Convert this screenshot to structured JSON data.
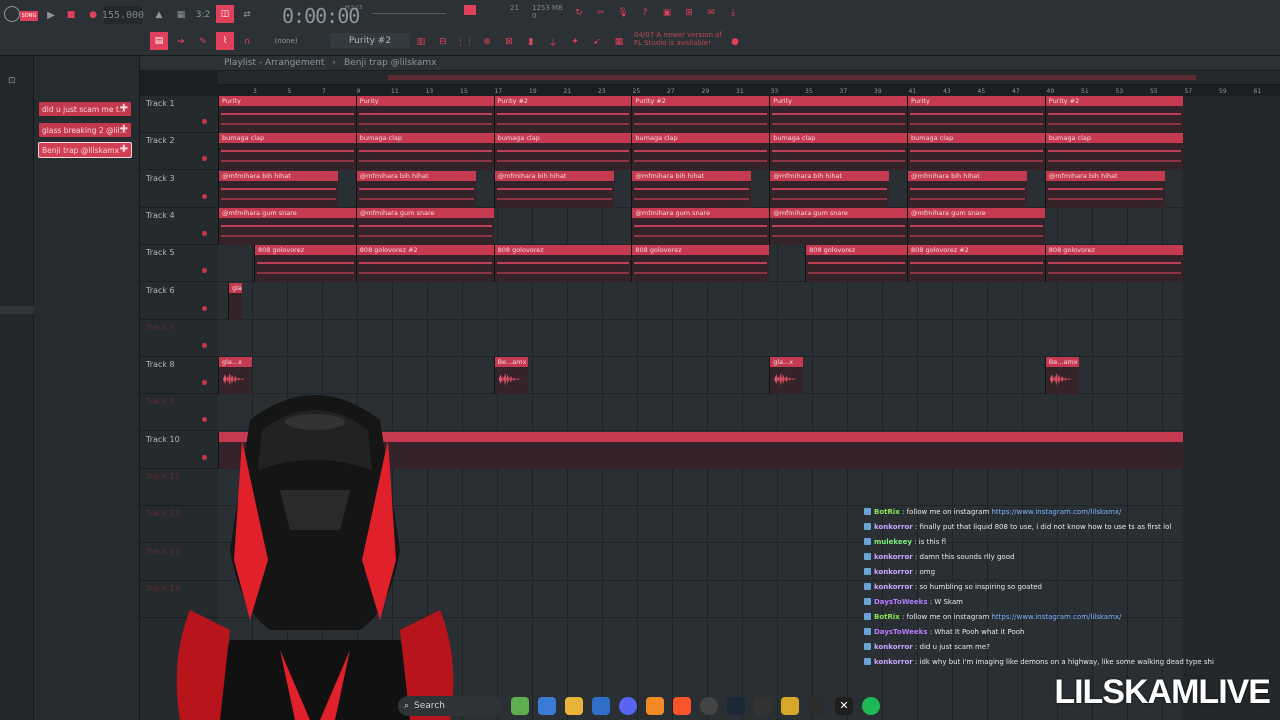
{
  "toolbar": {
    "tempo": "155.000",
    "clock": "0:00:00",
    "clock_unit": "M:S:CS",
    "counter": "21",
    "memory": "1253 MB",
    "memory_sub": "0",
    "pattern": "Purity #2",
    "snap": "(none)",
    "news_line1": "04/07 A newer version of",
    "news_line2": "FL Studio is available!"
  },
  "picker": {
    "items": [
      {
        "label": "did u just scam me t..."
      },
      {
        "label": "glass breaking 2 @lil..."
      },
      {
        "label": "Benji trap @lilskamx"
      }
    ]
  },
  "playlist": {
    "title": "Playlist - Arrangement",
    "arrangement": "Benji trap @lilskamx",
    "ruler": [
      "3",
      "5",
      "7",
      "9",
      "11",
      "13",
      "15",
      "17",
      "19",
      "21",
      "23",
      "25",
      "27",
      "29",
      "31",
      "33",
      "35",
      "37",
      "39",
      "41",
      "43",
      "45",
      "47",
      "49",
      "51",
      "53",
      "55",
      "57",
      "59",
      "61"
    ]
  },
  "tracks": [
    {
      "name": "Track 1"
    },
    {
      "name": "Track 2"
    },
    {
      "name": "Track 3"
    },
    {
      "name": "Track 4"
    },
    {
      "name": "Track 5"
    },
    {
      "name": "Track 6"
    },
    {
      "name": "Track 7"
    },
    {
      "name": "Track 8"
    },
    {
      "name": "Track 9"
    },
    {
      "name": "Track 10"
    },
    {
      "name": "Track 11"
    },
    {
      "name": "Track 12"
    },
    {
      "name": "Track 13"
    },
    {
      "name": "Track 14"
    }
  ],
  "clips": {
    "purity": "Purity",
    "purity2": "Purity #2",
    "clap": "bumaga clap",
    "hihat": "@mfmihara bih hihat",
    "snare": "@mfmihara gum snare",
    "bass": "808 golovorez",
    "bass2": "808 golovorez #2",
    "glass": "gla...x",
    "benji": "Be...amx"
  },
  "chat": [
    {
      "user": "BotRix",
      "color": "#8ee85b",
      "text": "follow me on instagram ",
      "link": "https://www.instagram.com/lilskamx/"
    },
    {
      "user": "konkorror",
      "color": "#c9a6ff",
      "text": "finally put that liquid 808 to use, i did not know how to use ts as first lol"
    },
    {
      "user": "mulekeey",
      "color": "#7cf07c",
      "text": "is this fl"
    },
    {
      "user": "konkorror",
      "color": "#c9a6ff",
      "text": "damn this sounds rlly good"
    },
    {
      "user": "konkorror",
      "color": "#c9a6ff",
      "text": "omg"
    },
    {
      "user": "konkorror",
      "color": "#c9a6ff",
      "text": "so humbling so inspiring so goated"
    },
    {
      "user": "DaysToWeeks",
      "color": "#b57bff",
      "text": "W Skam"
    },
    {
      "user": "BotRix",
      "color": "#8ee85b",
      "text": "follow me on instagram ",
      "link": "https://www.instagram.com/lilskamx/"
    },
    {
      "user": "DaysToWeeks",
      "color": "#b57bff",
      "text": "What It Pooh what it Pooh"
    },
    {
      "user": "konkorror",
      "color": "#c9a6ff",
      "text": "did u just scam me?"
    },
    {
      "user": "konkorror",
      "color": "#c9a6ff",
      "text": "idk why but i'm imaging like demons on a highway, like some walking dead type shi"
    }
  ],
  "brand": "LILSKAMLIVE",
  "taskbar": {
    "search": "Search"
  }
}
